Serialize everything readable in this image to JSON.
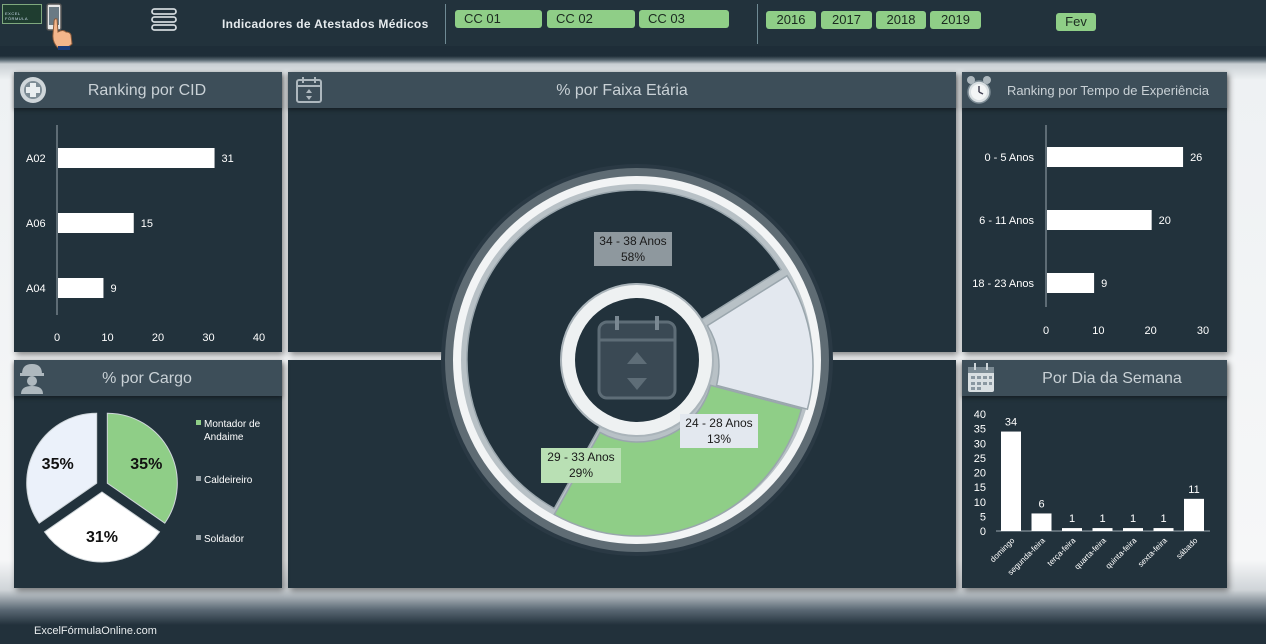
{
  "header": {
    "logo_text": "EXCEL FÓRMULA",
    "title": "Indicadores de Atestados Médicos",
    "cost_centers": [
      "CC 01",
      "CC 02",
      "CC 03"
    ],
    "years": [
      "2016",
      "2017",
      "2018",
      "2019"
    ],
    "month": "Fev"
  },
  "panels": {
    "cid": {
      "title": "Ranking por CID"
    },
    "faixa": {
      "title": "% por Faixa Etária"
    },
    "experiencia": {
      "title": "Ranking por Tempo de Experiência"
    },
    "cargo": {
      "title": "% por Cargo"
    },
    "dia": {
      "title": "Por Dia da Semana"
    }
  },
  "footer": {
    "text": "ExcelFórmulaOnline.com"
  },
  "chart_data": [
    {
      "id": "cid",
      "type": "bar",
      "orientation": "horizontal",
      "categories": [
        "A02",
        "A06",
        "A04"
      ],
      "values": [
        31,
        15,
        9
      ],
      "xlim": [
        0,
        40
      ],
      "xticks": [
        0,
        10,
        20,
        30,
        40
      ]
    },
    {
      "id": "experiencia",
      "type": "bar",
      "orientation": "horizontal",
      "categories": [
        "0 - 5 Anos",
        "6 - 11 Anos",
        "18 - 23 Anos"
      ],
      "values": [
        26,
        20,
        9
      ],
      "xlim": [
        0,
        30
      ],
      "xticks": [
        0,
        10,
        20,
        30
      ]
    },
    {
      "id": "faixa",
      "type": "pie",
      "style": "doughnut",
      "categories": [
        "34 - 38 Anos",
        "24 - 28 Anos",
        "29 - 33 Anos"
      ],
      "values": [
        58,
        13,
        29
      ],
      "labels": [
        "58%",
        "13%",
        "29%"
      ],
      "colors": [
        "#22323c",
        "#e3e8ef",
        "#8fce87"
      ]
    },
    {
      "id": "cargo",
      "type": "pie",
      "categories": [
        "Montador de Andaime",
        "Caldeireiro",
        "Soldador"
      ],
      "values": [
        35,
        31,
        35
      ],
      "labels": [
        "35%",
        "31%",
        "35%"
      ],
      "colors": [
        "#8fce87",
        "#ffffff",
        "#ebf1fa"
      ],
      "legend": "right"
    },
    {
      "id": "dia",
      "type": "bar",
      "categories": [
        "domingo",
        "segunda-feira",
        "terça-feira",
        "quarta-feira",
        "quinta-feira",
        "sexta-feira",
        "sábado"
      ],
      "values": [
        34,
        6,
        1,
        1,
        1,
        1,
        11
      ],
      "ylim": [
        0,
        40
      ],
      "yticks": [
        0,
        5,
        10,
        15,
        20,
        25,
        30,
        35,
        40
      ]
    }
  ]
}
